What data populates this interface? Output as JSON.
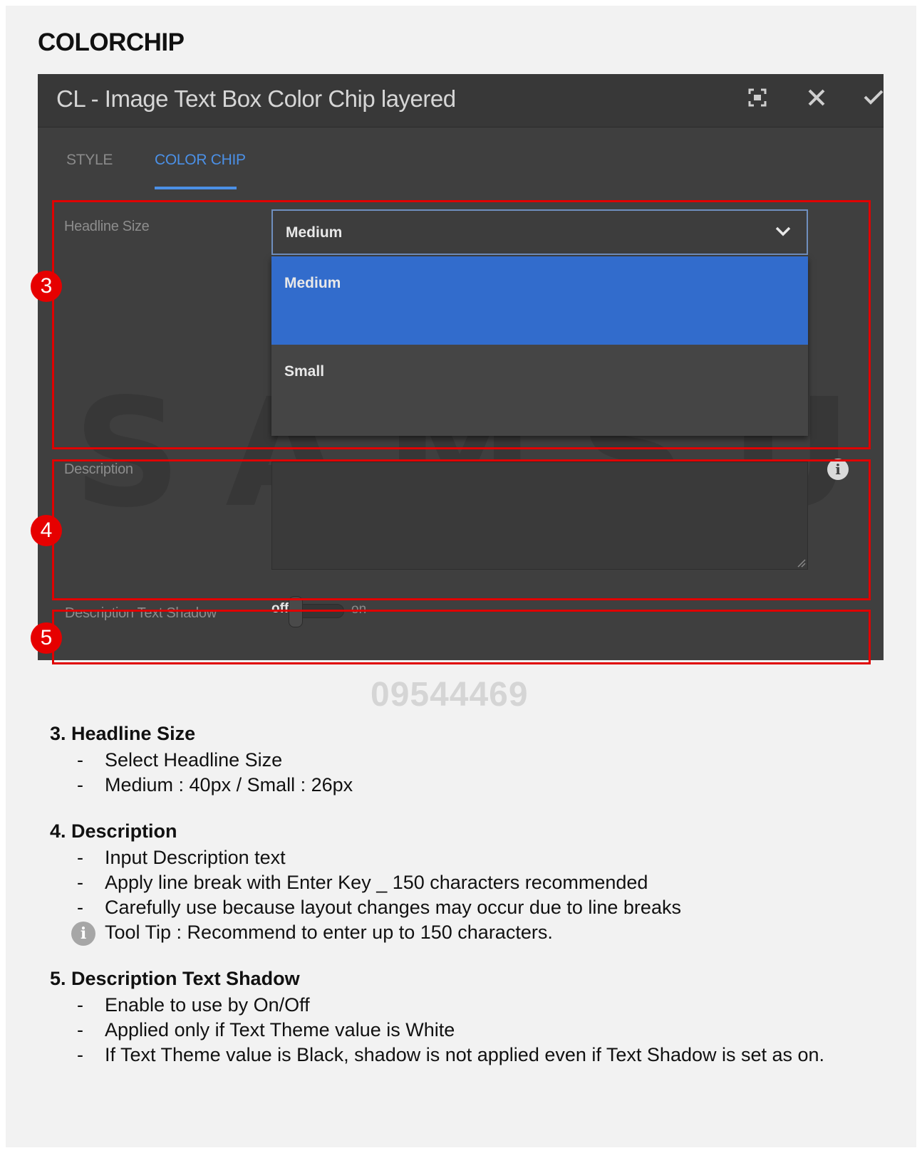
{
  "page": {
    "title": "COLORCHIP"
  },
  "dialog": {
    "title": "CL - Image Text Box Color Chip layered",
    "header_icons": [
      "fullscreen-icon",
      "close-icon",
      "check-icon"
    ],
    "tabs": [
      {
        "label": "STYLE",
        "active": false
      },
      {
        "label": "COLOR CHIP",
        "active": true
      }
    ],
    "headline_size": {
      "label": "Headline Size",
      "value": "Medium",
      "options": [
        {
          "label": "Medium",
          "selected": true
        },
        {
          "label": "Small",
          "selected": false
        }
      ]
    },
    "description": {
      "label": "Description",
      "value": ""
    },
    "text_shadow": {
      "label": "Description Text Shadow",
      "off_label": "off",
      "on_label": "on",
      "state": "off"
    }
  },
  "watermark": {
    "text": "SAMSUNG",
    "serial": "09544469"
  },
  "badges": [
    "3",
    "4",
    "5"
  ],
  "colors": {
    "annotation_red": "#e00000",
    "accent_blue": "#4b90e6",
    "selected_option": "#326ccc",
    "dialog_bg": "#3f3f3f"
  },
  "notes": [
    {
      "heading": "3. Headline Size",
      "items": [
        "Select Headline Size",
        "Medium : 40px / Small : 26px"
      ]
    },
    {
      "heading": "4. Description",
      "items": [
        "Input Description text",
        "Apply line break with Enter Key _ 150 characters recommended",
        "Carefully use because layout changes may occur due to line breaks"
      ],
      "tip": "Tool Tip : Recommend to enter up to 150 characters."
    },
    {
      "heading": "5. Description Text Shadow",
      "items": [
        "Enable to use by On/Off",
        "Applied only if Text Theme value is White",
        "If Text Theme value is Black, shadow is not applied even if Text Shadow is set as on."
      ]
    }
  ]
}
